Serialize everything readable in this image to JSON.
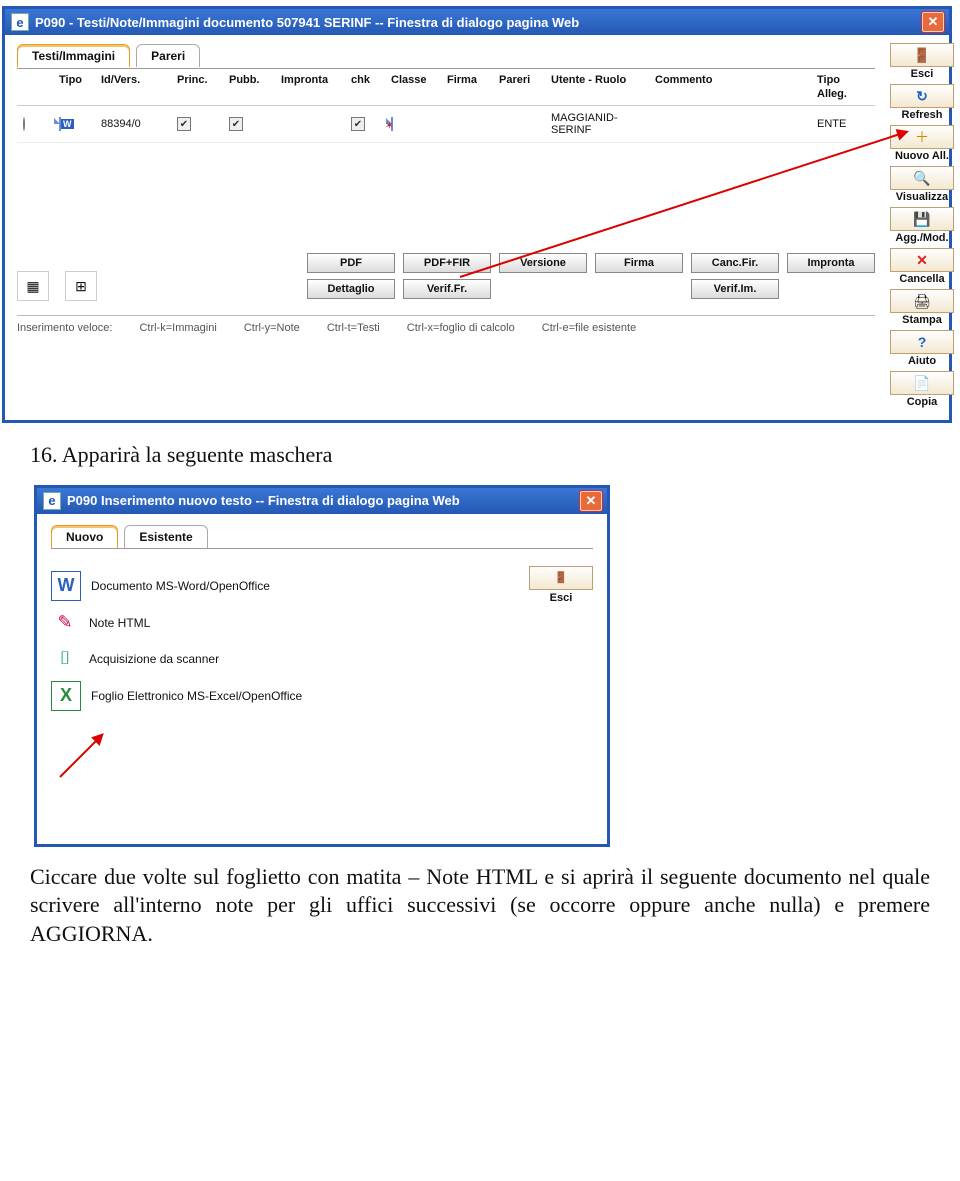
{
  "dialog1": {
    "title": "P090 - Testi/Note/Immagini documento 507941 SERINF -- Finestra di dialogo pagina Web",
    "tabs": [
      "Testi/Immagini",
      "Pareri"
    ],
    "headers": {
      "tipo": "Tipo",
      "id": "Id/Vers.",
      "princ": "Princ.",
      "pubb": "Pubb.",
      "impronta": "Impronta",
      "chk": "chk",
      "classe": "Classe",
      "firma": "Firma",
      "pareri": "Pareri",
      "utente": "Utente - Ruolo",
      "commento": "Commento",
      "tipoalleg": "Tipo Alleg."
    },
    "row": {
      "id": "88394/0",
      "utente": "MAGGIANID-SERINF",
      "tipoalleg": "ENTE",
      "princ_checked": true,
      "pubb_checked": true,
      "chk_checked": true
    },
    "lower_buttons_row1": [
      "PDF",
      "PDF+FIR",
      "Versione",
      "Firma",
      "Canc.Fir.",
      "Impronta"
    ],
    "lower_buttons_row2": [
      "Dettaglio",
      "Verif.Fr.",
      "Verif.Im."
    ],
    "hint_label": "Inserimento veloce:",
    "hints": [
      "Ctrl-k=Immagini",
      "Ctrl-y=Note",
      "Ctrl-t=Testi",
      "Ctrl-x=foglio di calcolo",
      "Ctrl-e=file esistente"
    ]
  },
  "sidebar": [
    {
      "key": "esci",
      "label": "Esci",
      "glyph": "🚪"
    },
    {
      "key": "refresh",
      "label": "Refresh",
      "glyph": "↻"
    },
    {
      "key": "nuovo",
      "label": "Nuovo All.",
      "glyph": "＋"
    },
    {
      "key": "visualizza",
      "label": "Visualizza",
      "glyph": "🔍"
    },
    {
      "key": "aggmod",
      "label": "Agg./Mod.",
      "glyph": "💾"
    },
    {
      "key": "cancella",
      "label": "Cancella",
      "glyph": "✕"
    },
    {
      "key": "stampa",
      "label": "Stampa",
      "glyph": "🖨"
    },
    {
      "key": "aiuto",
      "label": "Aiuto",
      "glyph": "?"
    },
    {
      "key": "copia",
      "label": "Copia",
      "glyph": "📄"
    }
  ],
  "mid_text": "16. Apparirà la seguente maschera",
  "dialog2": {
    "title": "P090 Inserimento nuovo testo -- Finestra di dialogo pagina Web",
    "tabs": [
      "Nuovo",
      "Esistente"
    ],
    "options": [
      {
        "key": "word",
        "label": "Documento MS-Word/OpenOffice"
      },
      {
        "key": "note",
        "label": "Note HTML"
      },
      {
        "key": "scan",
        "label": "Acquisizione da scanner"
      },
      {
        "key": "xls",
        "label": "Foglio Elettronico MS-Excel/OpenOffice"
      }
    ],
    "esci": "Esci"
  },
  "bottom_text": "Ciccare due volte sul foglietto con matita – Note HTML e si aprirà il seguente documento nel quale scrivere all'interno note per gli uffici successivi (se occorre oppure anche nulla) e premere AGGIORNA."
}
